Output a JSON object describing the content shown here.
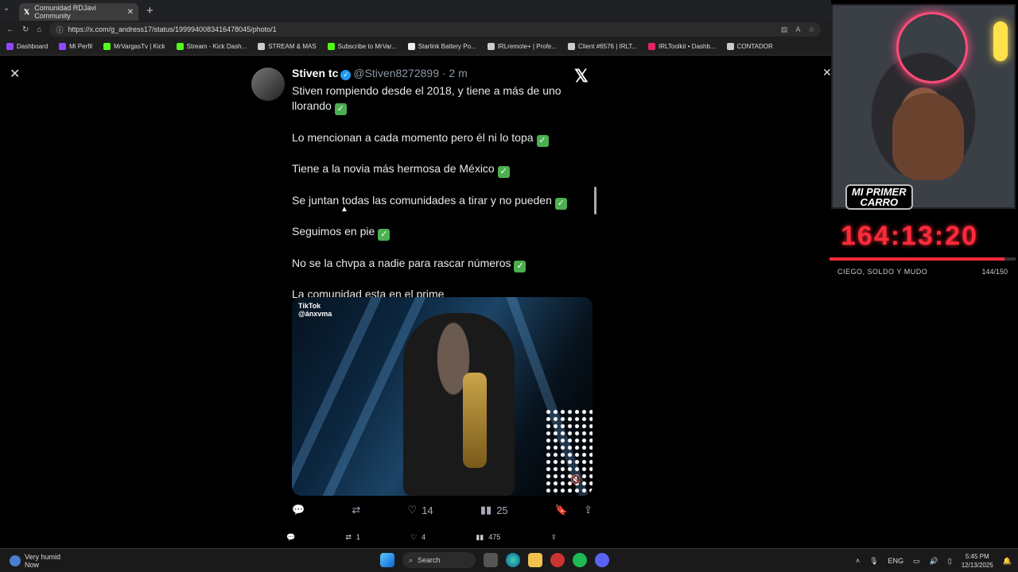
{
  "browser": {
    "tab_title": "Comunidad RDJavi Community",
    "url": "https://x.com/g_andress17/status/1999940083416478045/photo/1",
    "bookmarks": [
      {
        "label": "Dashboard",
        "color": "#9146ff"
      },
      {
        "label": "Mi Perfil",
        "color": "#9146ff"
      },
      {
        "label": "MrVargasTv | Kick",
        "color": "#53fc18"
      },
      {
        "label": "Stream - Kick Dash...",
        "color": "#53fc18"
      },
      {
        "label": "STREAM & MAS",
        "color": "#cccccc"
      },
      {
        "label": "Subscribe to MrVar...",
        "color": "#53fc18"
      },
      {
        "label": "Starlink Battery Po...",
        "color": "#eeeeee"
      },
      {
        "label": "IRLremote+ | Profe...",
        "color": "#cccccc"
      },
      {
        "label": "Client #6576 | IRLT...",
        "color": "#cccccc"
      },
      {
        "label": "IRLToolkit • Dashb...",
        "color": "#e0245e"
      },
      {
        "label": "CONTADOR",
        "color": "#cccccc"
      }
    ]
  },
  "tweet": {
    "author_name": "Stiven tc",
    "handle": "@Stiven8272899",
    "time": "· 2 m",
    "lines": [
      {
        "text": "Stiven rompiendo desde el 2018, y tiene a más de uno llorando",
        "check": true
      },
      {
        "text": "Lo mencionan a cada momento pero él ni lo topa",
        "check": true
      },
      {
        "text": "Tiene a la novia más hermosa de México",
        "check": true
      },
      {
        "text": "Se juntan todas las comunidades a tirar y no pueden",
        "check": true
      },
      {
        "text": "Seguimos en pie",
        "check": true
      },
      {
        "text": "No se la chvpa a nadie para rascar números",
        "check": true
      },
      {
        "text": "La comunidad esta en el prime",
        "check": false
      }
    ],
    "media_watermark": "TikTok",
    "media_watermark_user": "@ánxvma",
    "likes": "14",
    "views": "25"
  },
  "outer_post": {
    "retweets": "1",
    "likes": "4",
    "views": "475"
  },
  "taskbar": {
    "weather_title": "Very humid",
    "weather_sub": "Now",
    "search_label": "Search",
    "lang": "ENG",
    "time": "5:45 PM",
    "date": "12/13/2025"
  },
  "overlay": {
    "badge_line1": "MI PRIMER",
    "badge_line2": "CARRO",
    "timer": "164:13:20",
    "timer_progress": 0.94,
    "subtitle": "CIEGO, SOLDO Y MUDO",
    "count": "144/150"
  }
}
